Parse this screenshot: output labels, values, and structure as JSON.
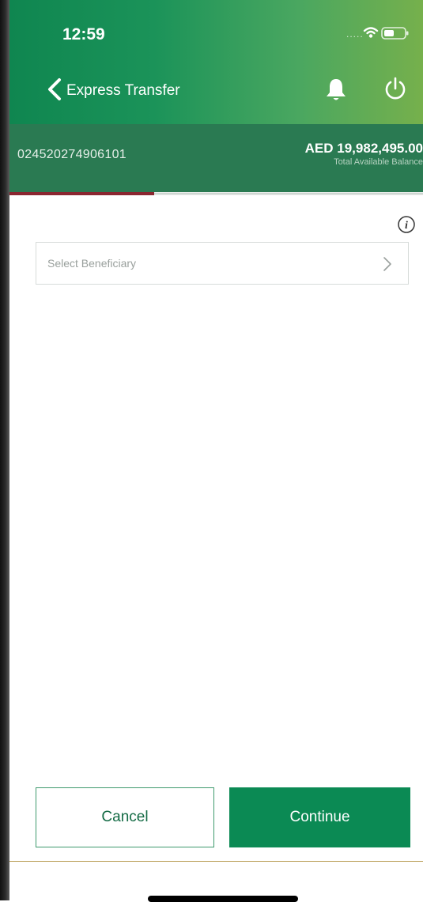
{
  "status_bar": {
    "time": "12:59",
    "signal_dots": "....."
  },
  "header": {
    "title": "Express Transfer",
    "back_icon": "chevron-left-icon",
    "notification_icon": "bell-icon",
    "logout_icon": "power-icon"
  },
  "account": {
    "number": "024520274906101",
    "balance": "AED 19,982,495.00",
    "balance_label": "Total Available Balance"
  },
  "progress": {
    "fraction": 0.35
  },
  "form": {
    "beneficiary_placeholder": "Select Beneficiary",
    "info_icon": "info-icon"
  },
  "actions": {
    "cancel_label": "Cancel",
    "continue_label": "Continue"
  },
  "colors": {
    "primary_green": "#0b8a54",
    "header_gradient_start": "#0f8650",
    "header_gradient_end": "#76b04c",
    "account_bar": "#2a7a52",
    "progress_accent": "#8a2630"
  }
}
